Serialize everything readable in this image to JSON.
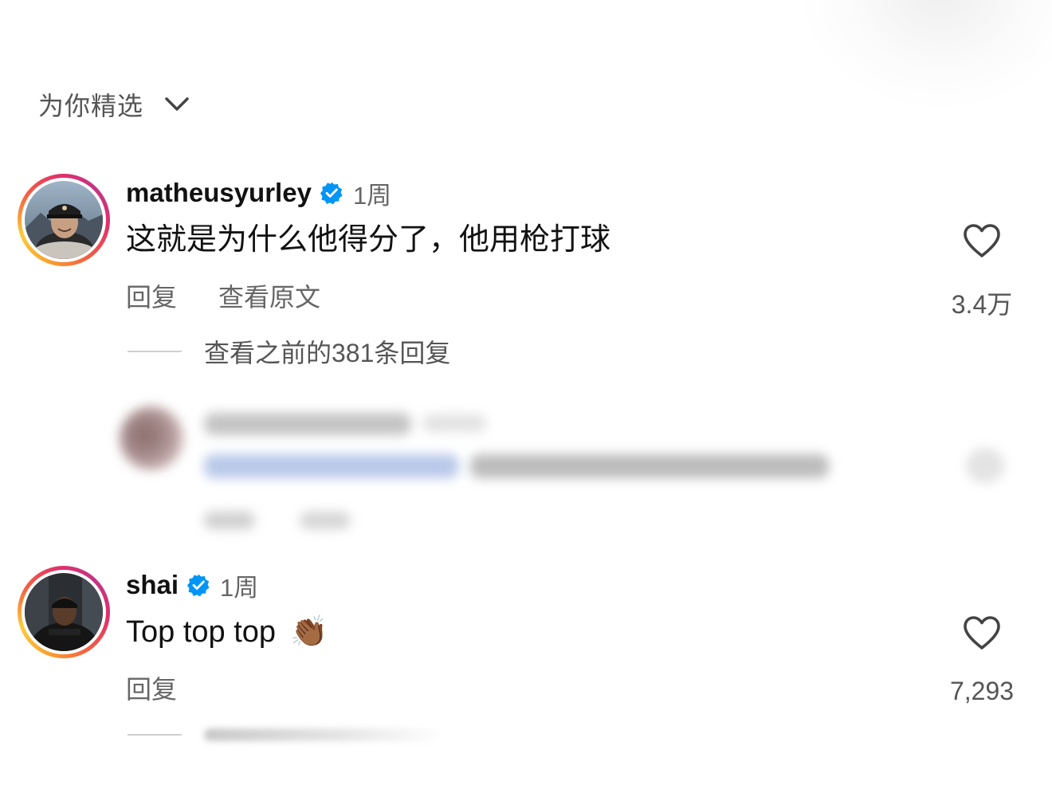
{
  "sort": {
    "label": "为你精选",
    "icon": "chevron-down-icon"
  },
  "comments": [
    {
      "username": "matheusyurley",
      "verified": true,
      "time": "1周",
      "text": "这就是为什么他得分了，他用枪打球",
      "actions": {
        "reply": "回复",
        "view_original": "查看原文"
      },
      "likes": "3.4万"
    },
    {
      "username": "shai",
      "verified": true,
      "time": "1周",
      "text": "Top top top",
      "emoji": "👏🏾",
      "actions": {
        "reply": "回复"
      },
      "likes": "7,293"
    }
  ],
  "replies_link": {
    "label": "查看之前的381条回复"
  },
  "colors": {
    "verified_badge": "#0095f6",
    "muted_text": "#666666",
    "primary_text": "#111111"
  }
}
